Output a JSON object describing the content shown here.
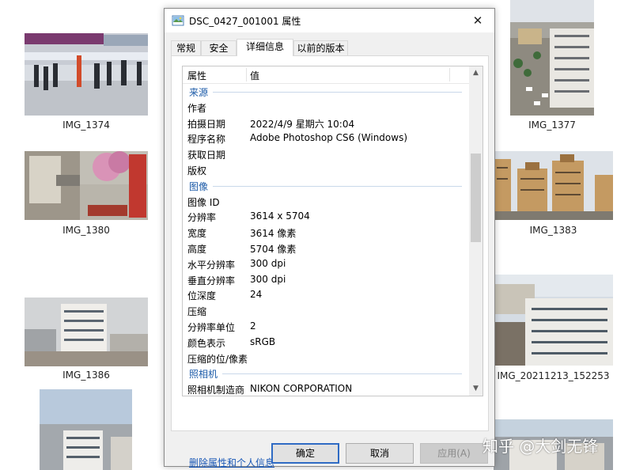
{
  "thumbnails": [
    {
      "id": "img1374",
      "caption": "IMG_1374"
    },
    {
      "id": "img1377",
      "caption": "IMG_1377"
    },
    {
      "id": "img1380",
      "caption": "IMG_1380"
    },
    {
      "id": "img1383",
      "caption": "IMG_1383"
    },
    {
      "id": "img1386",
      "caption": "IMG_1386"
    },
    {
      "id": "img20211213",
      "caption": "IMG_20211213_152253"
    }
  ],
  "dialog": {
    "title": "DSC_0427_001001 属性",
    "close_glyph": "✕",
    "tabs": [
      "常规",
      "安全",
      "详细信息",
      "以前的版本"
    ],
    "active_tab": "详细信息",
    "columns": {
      "property": "属性",
      "value": "值"
    },
    "rows": [
      {
        "type": "section",
        "label": "来源"
      },
      {
        "label": "作者",
        "value": ""
      },
      {
        "label": "拍摄日期",
        "value": "2022/4/9 星期六 10:04"
      },
      {
        "label": "程序名称",
        "value": "Adobe Photoshop CS6 (Windows)"
      },
      {
        "label": "获取日期",
        "value": ""
      },
      {
        "label": "版权",
        "value": ""
      },
      {
        "type": "section",
        "label": "图像"
      },
      {
        "label": "图像 ID",
        "value": ""
      },
      {
        "label": "分辨率",
        "value": "3614 x 5704"
      },
      {
        "label": "宽度",
        "value": "3614 像素"
      },
      {
        "label": "高度",
        "value": "5704 像素"
      },
      {
        "label": "水平分辨率",
        "value": "300 dpi"
      },
      {
        "label": "垂直分辨率",
        "value": "300 dpi"
      },
      {
        "label": "位深度",
        "value": "24"
      },
      {
        "label": "压缩",
        "value": ""
      },
      {
        "label": "分辨率单位",
        "value": "2"
      },
      {
        "label": "颜色表示",
        "value": "sRGB"
      },
      {
        "label": "压缩的位/像素",
        "value": ""
      },
      {
        "type": "section",
        "label": "照相机"
      },
      {
        "label": "照相机制造商",
        "value": "NIKON CORPORATION"
      }
    ],
    "remove_link": "删除属性和个人信息",
    "buttons": {
      "ok": "确定",
      "cancel": "取消",
      "apply": "应用(A)"
    }
  },
  "watermark": "知乎 @大剑无锋",
  "colors": {
    "accent": "#2f6bc4",
    "section": "#1c5ba8",
    "link": "#1a58b6"
  }
}
